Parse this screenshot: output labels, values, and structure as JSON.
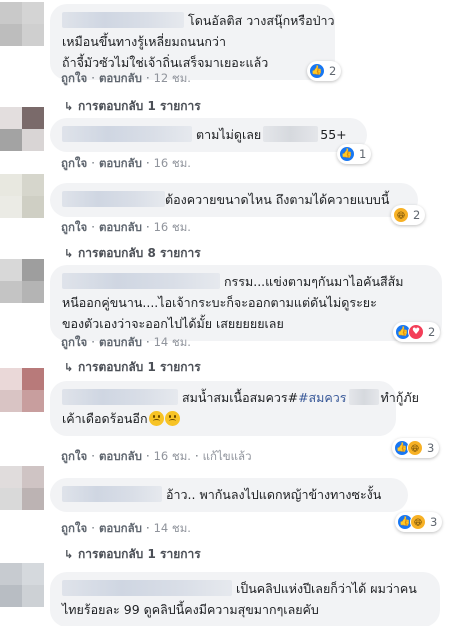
{
  "comments": [
    {
      "lines": [
        "โดนอัลติส วางสนุ๊กหรือป่าว",
        "เหมือนขึ้นทางรู้เหลี่ยมถนนกว่า",
        "ถ้าจี้มัวซัวไม่ใช่เจ้าถิ่นเสร็จมาเยอะแล้ว"
      ],
      "reaction_count": "2",
      "reactions": [
        "like"
      ],
      "like": "ถูกใจ",
      "reply": "ตอบกลับ",
      "time": "12 ชม.",
      "replies_label": "การตอบกลับ 1 รายการ",
      "avatar_colors": [
        "#c9c9c9",
        "#d4d4d4",
        "#bdbdbd",
        "#cfcfcf"
      ]
    },
    {
      "lines": [
        "ตามไม่ดูเลย",
        "55+"
      ],
      "reaction_count": "1",
      "reactions": [
        "like"
      ],
      "like": "ถูกใจ",
      "reply": "ตอบกลับ",
      "time": "16 ชม.",
      "avatar_colors": [
        "#e3dede",
        "#7a6a6a",
        "#a3a3a3",
        "#d9d5d5"
      ]
    },
    {
      "lines": [
        "ต้องควายขนาดไหน ถึงตามได้ควายแบบนี้"
      ],
      "reaction_count": "2",
      "reactions": [
        "haha"
      ],
      "like": "ถูกใจ",
      "reply": "ตอบกลับ",
      "time": "16 ชม.",
      "replies_label": "การตอบกลับ 8 รายการ",
      "avatar_colors": [
        "#e8e8e0",
        "#d6d6cc",
        "#ebebe5",
        "#cfcfc4"
      ]
    },
    {
      "lines": [
        "กรรม...แข่งตามๆกันมาไอคันสีส้ม",
        "หนีออกคู่ขนาน....ไอเจ้ากระบะก็จะออกตามแต่ดันไม่ดูระยะ",
        "ของตัวเองว่าจะออกไปได้มั้ย เสยยยยยเลย"
      ],
      "reaction_count": "2",
      "reactions": [
        "like",
        "love"
      ],
      "like": "ถูกใจ",
      "reply": "ตอบกลับ",
      "time": "14 ชม.",
      "replies_label": "การตอบกลับ 1 รายการ",
      "avatar_colors": [
        "#d8d8d8",
        "#9e9e9e",
        "#c4c4c4",
        "#b4b4b4"
      ]
    },
    {
      "lines": [
        "สมน้ำสมเนื้อสมควร##สมควร",
        "ทำกู้ภัย",
        "เค้าเดือดร้อนอีก"
      ],
      "hashtag1": "#สมควร",
      "reaction_count": "3",
      "reactions": [
        "like",
        "haha"
      ],
      "like": "ถูกใจ",
      "reply": "ตอบกลับ",
      "time": "16 ชม.",
      "extra": "แก้ไขแล้ว",
      "avatar_colors": [
        "#ead8d8",
        "#b87a7a",
        "#d9c4c4",
        "#c89e9e"
      ]
    },
    {
      "lines": [
        "อ้าว.. พากันลงไปแดกหญ้าข้างทางซะงั้น"
      ],
      "reaction_count": "3",
      "reactions": [
        "like",
        "haha"
      ],
      "like": "ถูกใจ",
      "reply": "ตอบกลับ",
      "time": "14 ชม.",
      "replies_label": "การตอบกลับ 1 รายการ",
      "avatar_colors": [
        "#e0dcdc",
        "#cfc4c4",
        "#d9d9d9",
        "#bcb3b3"
      ]
    },
    {
      "lines": [
        "เป็นคลิปแห่งปีเลยก็ว่าได้ ผมว่าคน",
        "ไทยร้อยละ 99 ดูคลิปนี้คงมีความสุขมากๆเลยคับ"
      ],
      "reaction_count": "",
      "reactions": [],
      "avatar_colors": [
        "#c7cbd0",
        "#d5d9dd",
        "#b8bdc3",
        "#cdd1d5"
      ]
    }
  ]
}
